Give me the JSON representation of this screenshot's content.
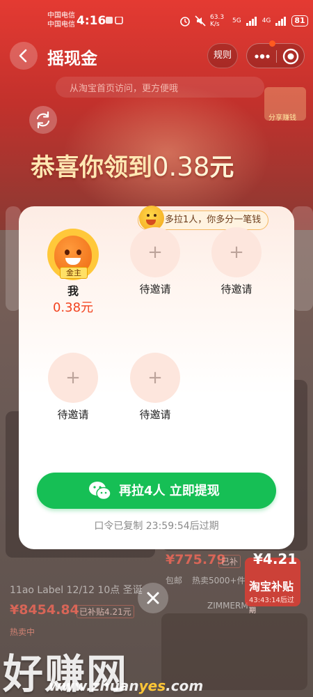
{
  "status_bar": {
    "carrier_1": "中国电信",
    "carrier_2": "中国电信",
    "time": "4:16",
    "speed": "63.3 K/s",
    "network_1": "5G",
    "network_2": "4G",
    "battery": "81"
  },
  "header": {
    "title": "摇现金",
    "rules_label": "规则",
    "hint": "从淘宝首页访问，更方便哦",
    "share_badge": "分享赚钱"
  },
  "congrats": {
    "text": "恭喜你领到",
    "amount": "0.38",
    "unit": "元"
  },
  "modal": {
    "tip": "多拉1人，你多分一笔钱",
    "me": {
      "badge": "金主",
      "name": "我",
      "amount": "0.38元"
    },
    "slots": [
      {
        "label": "待邀请"
      },
      {
        "label": "待邀请"
      },
      {
        "label": "待邀请"
      },
      {
        "label": "待邀请"
      }
    ],
    "plus_symbol": "+",
    "cta_label": "再拉4人 立即提现",
    "expire_text": "口令已复制 23:59:54后过期"
  },
  "background": {
    "product_1_title": "11ao Label 12/12 10点 圣诞",
    "product_1_price": "¥8454.84",
    "product_1_subsidy": "已补贴4.21元",
    "product_1_status": "热卖中",
    "product_2_price": "¥775.79",
    "product_2_subsidy": "已补",
    "product_2_tag": "包邮",
    "product_2_sales": "热卖5000+件",
    "subsidy_badge_price": "¥4.21",
    "subsidy_badge_title": "淘宝补贴",
    "subsidy_badge_timer": "43:43:14后过期",
    "brand": "ZIMMERM"
  },
  "watermark": {
    "text": "好赚网",
    "url_prefix": "www.zhuan",
    "url_highlight": "yes",
    "url_suffix": ".com"
  },
  "colors": {
    "cta_green": "#16bf55",
    "amount_red": "#f2431f",
    "congrats_gold": "#ffe7b3"
  }
}
